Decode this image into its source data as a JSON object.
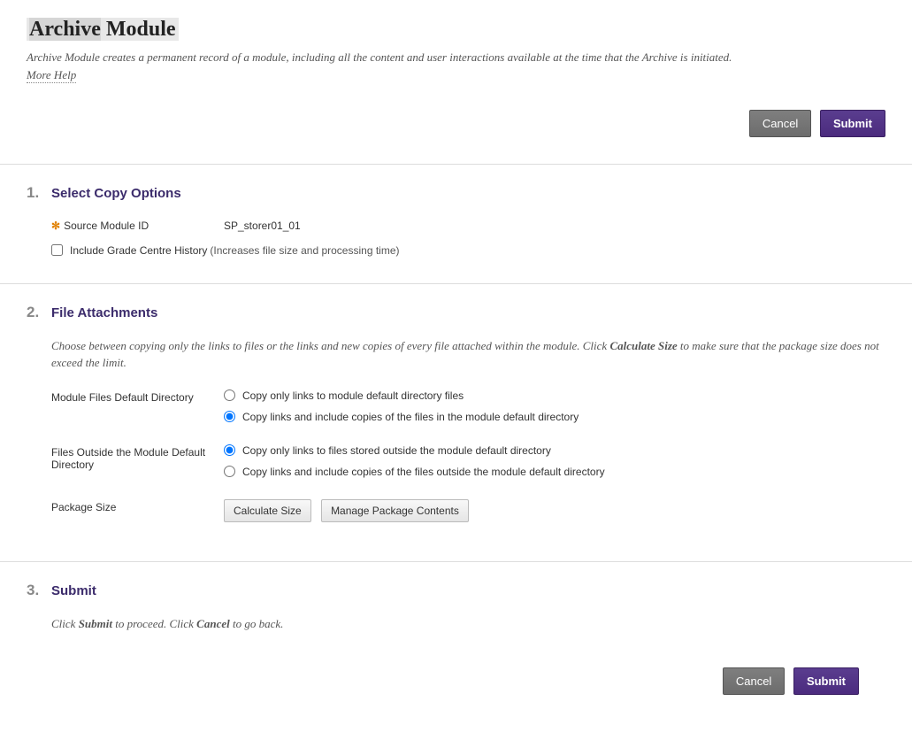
{
  "header": {
    "title_a": "Archive",
    "title_b": " Module",
    "description": "Archive Module creates a permanent record of a module, including all the content and user interactions available at the time that the Archive is initiated.",
    "more_help": "More Help"
  },
  "buttons": {
    "cancel": "Cancel",
    "submit": "Submit"
  },
  "section1": {
    "num": "1.",
    "title": "Select Copy Options",
    "source_label": "Source Module ID",
    "source_value": "SP_storer01_01",
    "include_history_label": "Include Grade Centre History",
    "include_history_hint": "(Increases file size and processing time)"
  },
  "section2": {
    "num": "2.",
    "title": "File Attachments",
    "desc_a": "Choose between copying only the links to files or the links and new copies of every file attached within the module. Click ",
    "desc_bold": "Calculate Size",
    "desc_b": " to make sure that the package size does not exceed the limit.",
    "default_dir_label": "Module Files Default Directory",
    "default_opt1": "Copy only links to module default directory files",
    "default_opt2": "Copy links and include copies of the files in the module default directory",
    "outside_dir_label": "Files Outside the Module Default Directory",
    "outside_opt1": "Copy only links to files stored outside the module default directory",
    "outside_opt2": "Copy links and include copies of the files outside the module default directory",
    "package_size_label": "Package Size",
    "calc_btn": "Calculate Size",
    "manage_btn": "Manage Package Contents"
  },
  "section3": {
    "num": "3.",
    "title": "Submit",
    "desc_a": "Click ",
    "desc_submit": "Submit",
    "desc_b": " to proceed. Click ",
    "desc_cancel": "Cancel",
    "desc_c": " to go back."
  }
}
